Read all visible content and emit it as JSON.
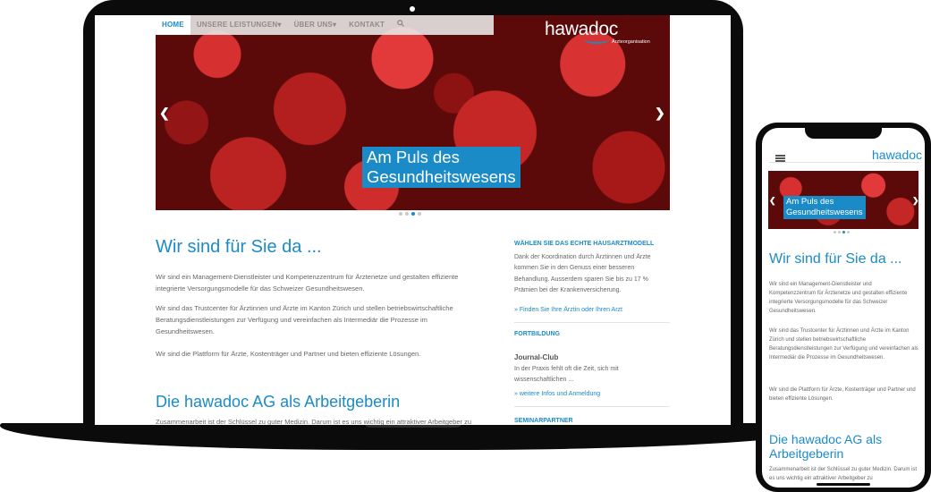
{
  "nav": {
    "items": [
      "HOME",
      "UNSERE LEISTUNGEN",
      "ÜBER UNS",
      "KONTAKT"
    ],
    "search_icon": "search-icon"
  },
  "logo": {
    "text": "hawadoc",
    "subtitle": "Ärzteorganisation"
  },
  "hero": {
    "caption_line1": "Am Puls des",
    "caption_line2": "Gesundheitswesens",
    "slides": 4,
    "active_slide": 3
  },
  "main": {
    "heading": "Wir sind für Sie da ...",
    "paragraphs": [
      "Wir sind ein Management-Dienstleister und Kompetenzzentrum für Ärztenetze und gestalten effiziente integrierte Versorgungsmodelle für das Schweizer Gesundheitswesen.",
      "Wir sind das Trustcenter für Ärztinnen und Ärzte im Kanton Zürich und stellen betriebswirtschaftliche Beratungsdienstleistungen zur Verfügung und vereinfachen als Intermediär die Prozesse im Gesundheitswesen.",
      "Wir sind die Plattform für Ärzte, Kostenträger und Partner und bieten effiziente Lösungen."
    ],
    "heading2": "Die hawadoc AG als Arbeitgeberin",
    "teaser": "Zusammenarbeit ist der Schlüssel zu guter Medizin. Darum ist es uns wichtig ein attraktiver Arbeitgeber zu"
  },
  "sidebar": {
    "block1_title": "WÄHLEN SIE DAS ECHTE HAUSARZTMODELL",
    "block1_text": "Dank der Koordination durch Ärztinnen und Ärzte kommen Sie in den Genuss einer besseren Behandlung. Ausserdem sparen Sie bis zu 17 % Prämien bei der Krankenversicherung.",
    "block1_link": "» Finden Sie Ihre Ärztin oder Ihren Arzt",
    "block2_title": "FORTBILDUNG",
    "block2_subtitle": "Journal-Club",
    "block2_text": "In der Praxis fehlt oft die Zeit, sich mit wissenschaftlichen ...",
    "block2_link": "» weitere Infos und Anmeldung",
    "block3_title": "SEMINARPARTNER"
  },
  "phone": {
    "logo": "hawadoc",
    "caption_line1": "Am Puls des",
    "caption_line2": "Gesundheitswesens",
    "heading": "Wir sind für Sie da ...",
    "paragraphs": [
      "Wir sind ein Management-Dienstleister und Kompetenzzentrum für Ärztenetze und gestalten effiziente integrierte Versorgungsmodelle für das Schweizer Gesundheitswesen.",
      "Wir sind das Trustcenter für Ärztinnen und Ärzte im Kanton Zürich und stellen betriebswirtschaftliche Beratungsdienstleistungen zur Verfügung und vereinfachen als Intermediär die Prozesse im Gesundheitswesen.",
      "Wir sind die Plattform für Ärzte, Kostenträger und Partner und bieten effiziente Lösungen."
    ],
    "heading2": "Die hawadoc AG als Arbeitgeberin",
    "teaser": "Zusammenarbeit ist der Schlüssel zu guter Medizin. Darum ist es uns wichtig ein attraktiver Arbeitgeber zu"
  },
  "colors": {
    "accent": "#1b8bc8",
    "frame": "#0b0b0b"
  }
}
